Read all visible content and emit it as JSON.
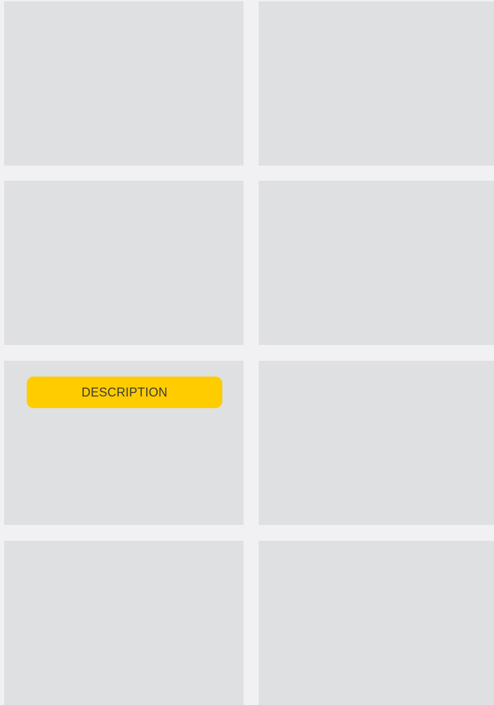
{
  "tiles": {
    "description_button_label": "DESCRIPTION"
  },
  "colors": {
    "background": "#f1f1f3",
    "tile": "#dfe0e2",
    "button": "#ffcc00",
    "button_text": "#3a3a3a"
  }
}
